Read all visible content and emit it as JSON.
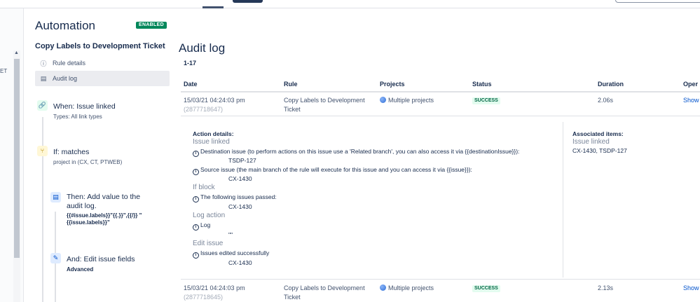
{
  "sidebar": {
    "title": "Automation",
    "badge": "ENABLED",
    "rule_name": "Copy Labels to Development Ticket",
    "nav": [
      {
        "label": "Rule details",
        "icon": "info-icon"
      },
      {
        "label": "Audit log",
        "icon": "document-icon"
      }
    ],
    "components": [
      {
        "title": "When: Issue linked",
        "sub": "Types: All link types",
        "icon": "link-icon"
      },
      {
        "title": "If: matches",
        "sub": "project in (CX, CT, PTWEB)",
        "icon": "branch-icon"
      },
      {
        "title": "Then: Add value to the audit log.",
        "code": "{{#issue.labels}}\"{{.}}\",{{/}} \"{{issue.labels}}\"",
        "icon": "log-icon"
      },
      {
        "title": "And: Edit issue fields",
        "sub": "Advanced",
        "icon": "pencil-icon"
      }
    ],
    "left_fragment": "ET"
  },
  "main": {
    "title": "Audit log",
    "range": "1-17",
    "columns": [
      "Date",
      "Rule",
      "Projects",
      "Status",
      "Duration",
      "Oper"
    ],
    "rows": [
      {
        "date": "15/03/21 04:24:03 pm",
        "id": "(2877718647)",
        "rule": "Copy Labels to Development Ticket",
        "projects": "Multiple projects",
        "status": "SUCCESS",
        "duration": "2.06s",
        "action": "Show"
      },
      {
        "date": "15/03/21 04:24:03 pm",
        "id": "(2877718645)",
        "rule": "Copy Labels to Development Ticket",
        "projects": "Multiple projects",
        "status": "SUCCESS",
        "duration": "2.13s",
        "action": "Show"
      }
    ],
    "details": {
      "heading": "Action details:",
      "issue_linked": {
        "title": "Issue linked",
        "dest_text": "Destination issue (to perform actions on this issue use a 'Related branch', you can also access it via {{destinationIssue}}):",
        "dest_value": "TSDP-127",
        "source_text": "Source issue (the main branch of the rule will execute for this issue and you can access it via {{issue}}):",
        "source_value": "CX-1430"
      },
      "if_block": {
        "title": "If block",
        "text": "The following issues passed:",
        "value": "CX-1430"
      },
      "log_action": {
        "title": "Log action",
        "text": "Log",
        "value": "\"\""
      },
      "edit_issue": {
        "title": "Edit issue",
        "text": "Issues edited successfully",
        "value": "CX-1430"
      },
      "associated": {
        "heading": "Associated items:",
        "title": "Issue linked",
        "links": "CX-1430, TSDP-127"
      }
    }
  }
}
